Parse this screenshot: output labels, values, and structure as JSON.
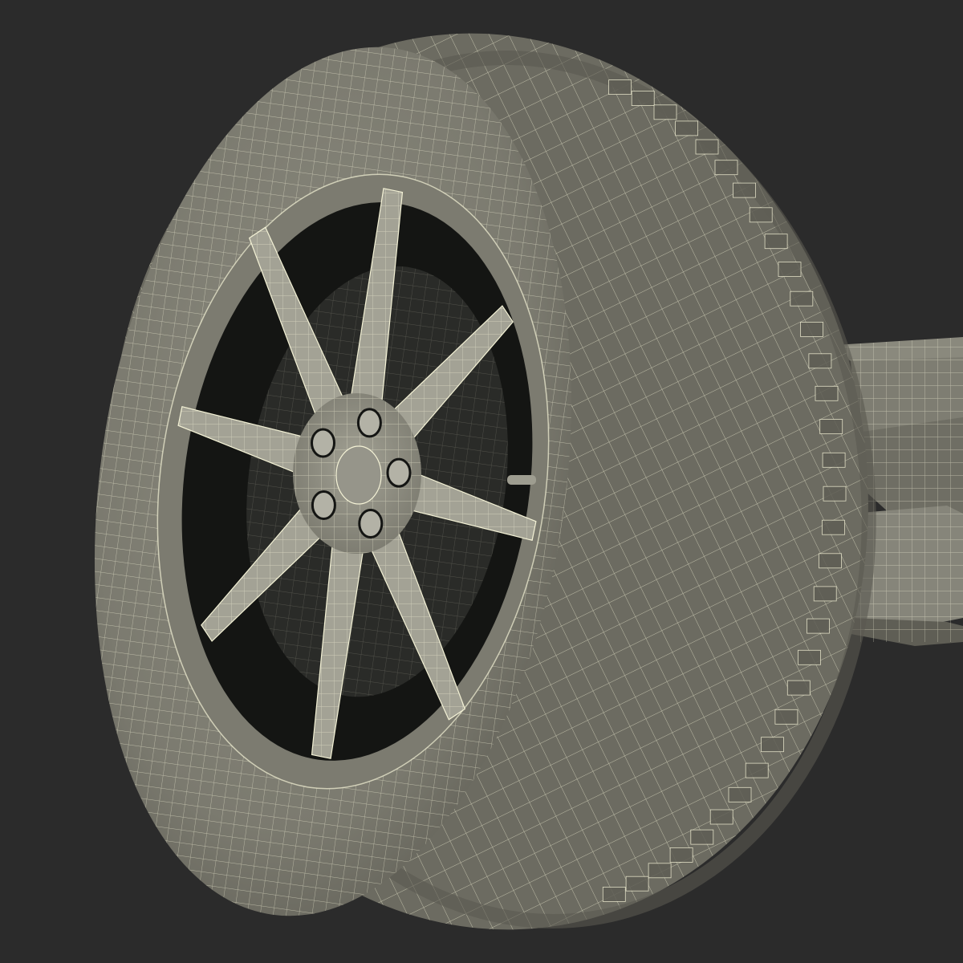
{
  "scene": {
    "subject": "wheel-wireframe-render",
    "colors": {
      "background": "#2b2b2b",
      "surface": "#86857a",
      "surface_light": "#a3a295",
      "surface_dark": "#5f5e55",
      "wire": "#f4f2d6",
      "cavity": "#141513",
      "cavity_mid": "#2a2b28"
    },
    "rim": {
      "spoke_count": 8,
      "lug_nut_count": 5
    }
  }
}
